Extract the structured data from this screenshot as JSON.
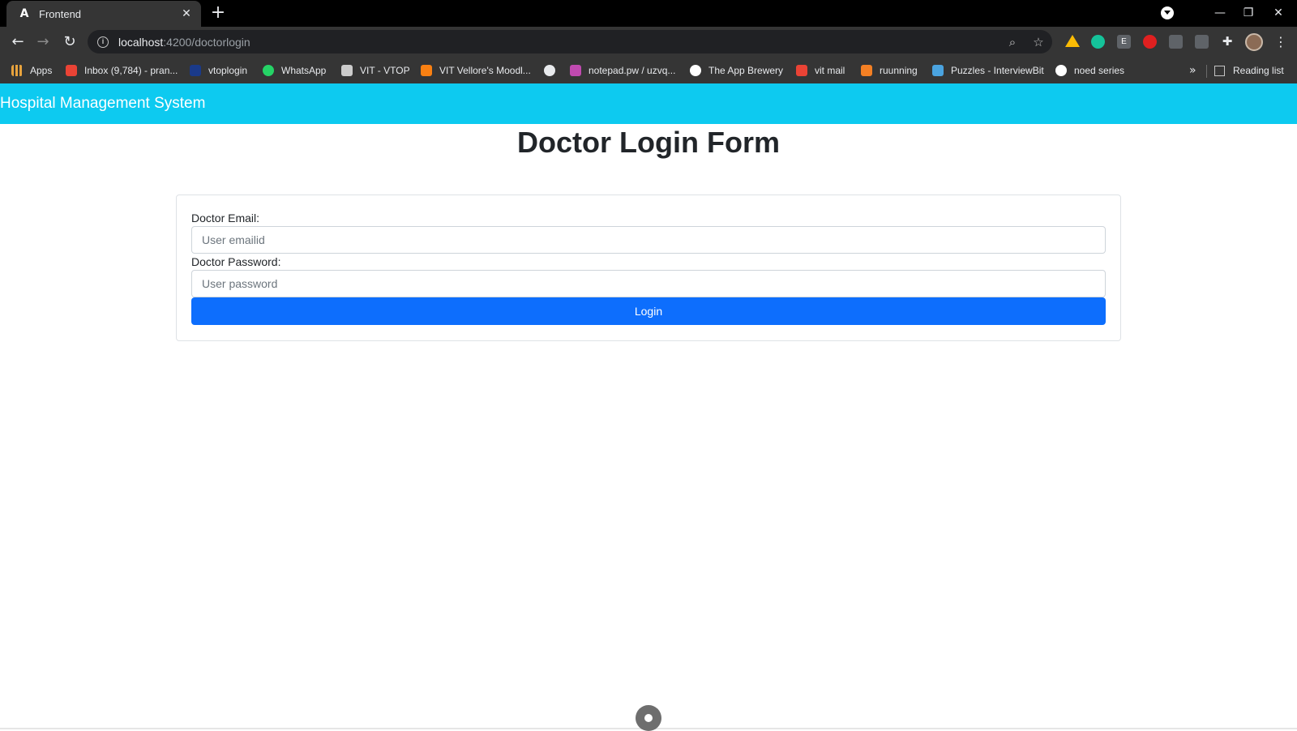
{
  "browser": {
    "tab": {
      "title": "Frontend",
      "favicon": "angular-icon",
      "favicon_glyph": "A",
      "close_glyph": "✕"
    },
    "new_tab_glyph": "+",
    "window_controls": {
      "minimize": "—",
      "restore": "❐",
      "close": "✕"
    },
    "nav": {
      "back": "←",
      "forward": "→",
      "reload": "↻"
    },
    "address": {
      "host": "localhost",
      "path": ":4200/doctorlogin"
    },
    "omnibox_icons": {
      "zoom": "⌕",
      "bookmark": "☆"
    },
    "extensions_glyph": "✚",
    "menu_glyph": "⋮",
    "bookmarks": [
      {
        "label": "Apps",
        "icon": "apps-grid-icon",
        "color": "#e8a33d"
      },
      {
        "label": "Inbox (9,784) - pran...",
        "icon": "gmail-icon",
        "color": "#ea4335"
      },
      {
        "label": "vtoplogin",
        "icon": "vtop-icon",
        "color": "#1a3a8a"
      },
      {
        "label": "WhatsApp",
        "icon": "whatsapp-icon",
        "color": "#25d366"
      },
      {
        "label": "VIT - VTOP",
        "icon": "vtop-page-icon",
        "color": "#cccccc"
      },
      {
        "label": "VIT Vellore's Moodl...",
        "icon": "moodle-icon",
        "color": "#f98012"
      },
      {
        "label": "",
        "icon": "globe-icon",
        "color": "#e8eaed"
      },
      {
        "label": "notepad.pw / uzvq...",
        "icon": "notepad-icon",
        "color": "#c04ab0"
      },
      {
        "label": "The App Brewery",
        "icon": "app-brewery-icon",
        "color": "#ffffff"
      },
      {
        "label": "vit mail",
        "icon": "gmail-icon",
        "color": "#ea4335"
      },
      {
        "label": "ruunning",
        "icon": "stack-icon",
        "color": "#f48024"
      },
      {
        "label": "Puzzles - InterviewBit",
        "icon": "interviewbit-icon",
        "color": "#4aa3df"
      },
      {
        "label": "noed series",
        "icon": "github-icon",
        "color": "#ffffff"
      }
    ],
    "more_bookmarks_glyph": "»",
    "reading_list": "Reading list"
  },
  "page": {
    "brand": "Hospital Management System",
    "heading": "Doctor Login Form",
    "form": {
      "email_label": "Doctor Email:",
      "email_placeholder": "User emailid",
      "email_value": "",
      "password_label": "Doctor Password:",
      "password_placeholder": "User password",
      "password_value": "",
      "submit_label": "Login"
    }
  },
  "colors": {
    "navbar": "#0dcaf0",
    "button": "#0d6efd",
    "heading": "#212529"
  }
}
